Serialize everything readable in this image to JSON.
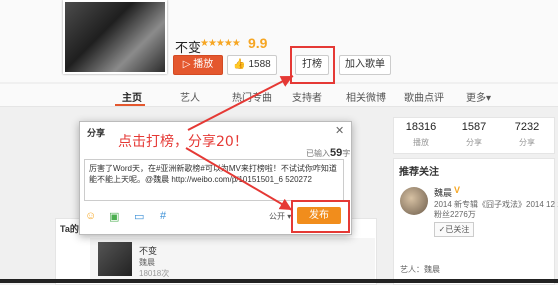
{
  "song": {
    "title": "不变",
    "stars": "★★★★★",
    "score": "9.9"
  },
  "buttons": {
    "play": "▷ 播放",
    "like": "👍 1588",
    "rank": "打榜",
    "add": "加入歌单"
  },
  "tabs": [
    "主页",
    "艺人",
    "热门专曲",
    "支持者",
    "相关微博",
    "歌曲点评",
    "更多▾"
  ],
  "stats": [
    {
      "num": "18316",
      "label": "播放"
    },
    {
      "num": "1587",
      "label": "分享"
    },
    {
      "num": "7232",
      "label": "分享"
    }
  ],
  "recommend": {
    "title": "推荐关注",
    "name": "魏晨",
    "badge": "V",
    "desc": "2014 新专辑《囧子戏法》2014 12 12...",
    "fans": "粉丝2276万",
    "follow": "✓已关注",
    "artist_line": "艺人：魏晨"
  },
  "list": {
    "title": "Ta的歌曲",
    "name": "不变",
    "artist": "魏晨",
    "extra": "18018次"
  },
  "dialog": {
    "title": "分享",
    "close": "✕",
    "count_prefix": "已输入",
    "count_num": "59",
    "count_suffix": "字",
    "text": "厉害了Word天，在#亚洲新歌榜#可以为MV来打榜啦！不试试你咋知道能不能上天呢。@魏晨 http://weibo.com/p/10151501_6 520272",
    "visibility": "公开 ▾",
    "send": "发布"
  },
  "annotation": "点击打榜，分享20！",
  "colors": {
    "accent": "#e4572e",
    "annotation": "#e53935",
    "send": "#f18d1c"
  }
}
